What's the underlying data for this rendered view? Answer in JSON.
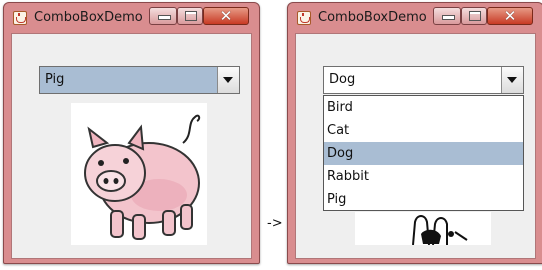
{
  "left_window": {
    "title": "ComboBoxDemo",
    "controls": {
      "close": "✕"
    },
    "combo": {
      "selected": "Pig"
    },
    "image": {
      "subject": "pig"
    }
  },
  "transition_text": "->",
  "right_window": {
    "title": "ComboBoxDemo",
    "controls": {
      "close": "✕"
    },
    "combo": {
      "selected": "Dog",
      "items": [
        "Bird",
        "Cat",
        "Dog",
        "Rabbit",
        "Pig"
      ],
      "highlighted_index": 2
    },
    "image": {
      "subject": "dog"
    }
  },
  "colors": {
    "title_bar": "#d98d8f",
    "content_bg": "#efefef",
    "selection": "#a9bdd3",
    "close_button": "#c83a24"
  },
  "icons": [
    "java-app-icon",
    "minimize-icon",
    "maximize-icon",
    "close-icon",
    "dropdown-arrow-icon"
  ]
}
